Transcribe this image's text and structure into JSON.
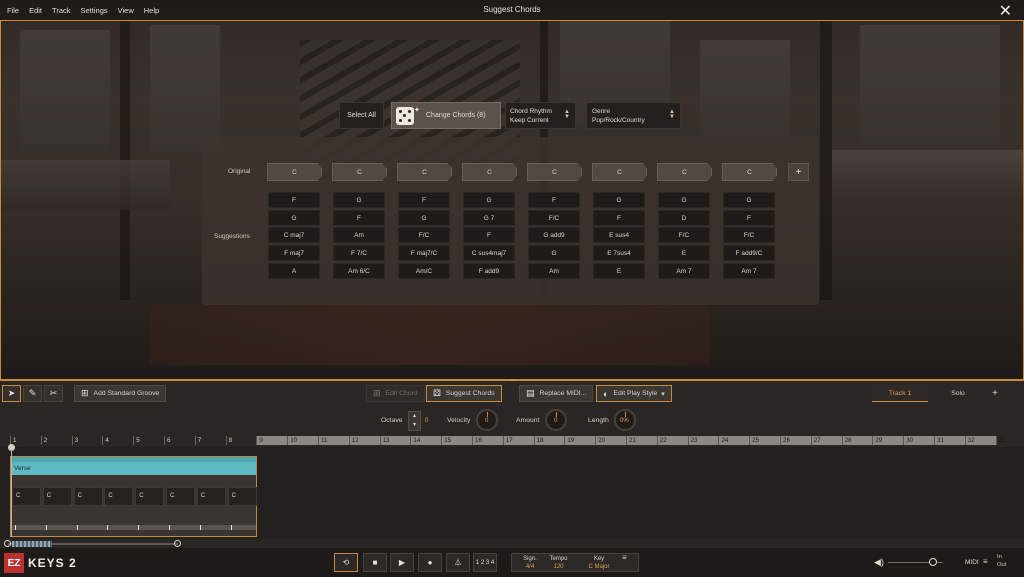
{
  "menu": [
    "File",
    "Edit",
    "Track",
    "Settings",
    "View",
    "Help"
  ],
  "window_title": "Suggest Chords",
  "toolbar": {
    "select_all": "Select All",
    "change_chords": "Change Chords (8)",
    "chord_rhythm_label": "Chord Rhythm",
    "chord_rhythm_value": "Keep Current",
    "genre_label": "Genre",
    "genre_value": "Pop/Rock/Country"
  },
  "panel": {
    "original_label": "Original",
    "suggestions_label": "Suggestions",
    "original": [
      "C",
      "C",
      "C",
      "C",
      "C",
      "C",
      "C",
      "C"
    ],
    "add_symbol": "+",
    "suggestions": [
      [
        "F",
        "G",
        "C maj7",
        "F maj7",
        "A"
      ],
      [
        "G",
        "F",
        "Am",
        "F 7/C",
        "Am 6/C"
      ],
      [
        "F",
        "G",
        "F/C",
        "F maj7/C",
        "Am/C"
      ],
      [
        "G",
        "G 7",
        "F",
        "C sus4maj7",
        "F add9"
      ],
      [
        "F",
        "F/C",
        "G add9",
        "G",
        "Am"
      ],
      [
        "G",
        "F",
        "E sus4",
        "E 7sus4",
        "E"
      ],
      [
        "G",
        "D",
        "F/C",
        "E",
        "Am 7"
      ],
      [
        "G",
        "F",
        "F/C",
        "F add9/C",
        "Am 7"
      ]
    ]
  },
  "lower_toolbar": {
    "add_standard_groove": "Add Standard Groove",
    "edit_chord": "Edit Chord",
    "suggest_chords": "Suggest Chords",
    "replace_midi": "Replace MIDI...",
    "edit_play_style": "Edit Play Style",
    "track_tab": "Track 1",
    "solo_tab": "Solo",
    "add_track": "+"
  },
  "params": {
    "octave_label": "Octave",
    "octave_value": "0",
    "velocity_label": "Velocity",
    "velocity_value": "0",
    "amount_label": "Amount",
    "amount_value": "0",
    "length_label": "Length",
    "length_value": "0%"
  },
  "ruler": [
    "1",
    "2",
    "3",
    "4",
    "5",
    "6",
    "7",
    "8",
    "9",
    "10",
    "11",
    "12",
    "13",
    "14",
    "15",
    "16",
    "17",
    "18",
    "19",
    "20",
    "21",
    "22",
    "23",
    "24",
    "25",
    "26",
    "27",
    "28",
    "29",
    "30",
    "31",
    "32",
    "33"
  ],
  "region": {
    "part_name": "Verse",
    "chords": [
      "C",
      "C",
      "C",
      "C",
      "C",
      "C",
      "C",
      "C"
    ]
  },
  "transport": {
    "logo_ez": "EZ",
    "logo_keys": "KEYS 2",
    "count_in": "1 2 3 4",
    "sign_label": "Sign.",
    "sign_value": "4/4",
    "tempo_label": "Tempo",
    "tempo_value": "120",
    "key_label": "Key",
    "key_value": "C Major",
    "midi_label": "MIDI",
    "in_label": "In",
    "out_label": "Out"
  },
  "colors": {
    "accent": "#c68a3a",
    "part_color": "#5fb9c3",
    "logo_red": "#b8312f"
  }
}
